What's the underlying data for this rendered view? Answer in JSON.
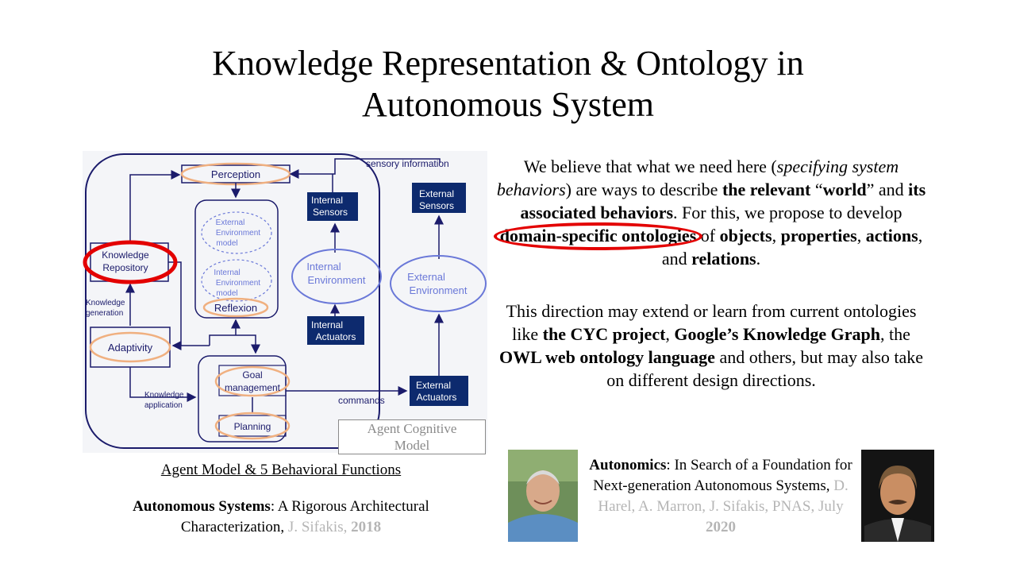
{
  "slide": {
    "title_line1": "Knowledge Representation & Ontology in",
    "title_line2": "Autonomous System"
  },
  "diagram": {
    "perception": "Perception",
    "sensory_information": "sensory information",
    "internal_sensors_1": "Internal",
    "internal_sensors_2": "Sensors",
    "external_sensors_1": "External",
    "external_sensors_2": "Sensors",
    "knowledge_repository_1": "Knowledge",
    "knowledge_repository_2": "Repository",
    "external_env_model_1": "External",
    "external_env_model_2": "Environment",
    "external_env_model_3": "model",
    "internal_env_model_1": "Internal",
    "internal_env_model_2": "Environment",
    "internal_env_model_3": "model",
    "internal_environment_1": "Internal",
    "internal_environment_2": "Environment",
    "external_environment_1": "External",
    "external_environment_2": "Environment",
    "knowledge_generation_1": "Knowledge",
    "knowledge_generation_2": "generation",
    "reflexion": "Reflexion",
    "internal_actuators_1": "Internal",
    "internal_actuators_2": "Actuators",
    "adaptivity": "Adaptivity",
    "goal_management_1": "Goal",
    "goal_management_2": "management",
    "knowledge_application_1": "Knowledge",
    "knowledge_application_2": "application",
    "commands": "commands",
    "external_actuators_1": "External",
    "external_actuators_2": "Actuators",
    "planning": "Planning",
    "agent_cognitive_model_1": "Agent Cognitive",
    "agent_cognitive_model_2": "Model",
    "colors": {
      "navy": "#1b1b6b",
      "box_fill": "#0d2a6e",
      "orange": "#f0b080",
      "red": "#e30000",
      "blue_ellipse": "#6a78d8"
    }
  },
  "left_caption": "Agent Model & 5 Behavioral Functions",
  "left_ref": {
    "bold": "Autonomous Systems",
    "text1": ": A Rigorous Architectural",
    "text2": "Characterization, ",
    "gray": "J. Sifakis, ",
    "year": "2018"
  },
  "para1": {
    "t1": "We believe that what we need here (",
    "i1": "specifying system behaviors",
    "t2": ") are ways to describe ",
    "b1": "the relevant",
    "t3": " “",
    "b2": "world",
    "t4": "” and ",
    "b3": "its associated behaviors",
    "t5": ". For this, we propose to develop ",
    "b4": "domain-specific ontologies",
    "t6": " of ",
    "b5": "objects",
    "t7": ", ",
    "b6": "properties",
    "t8": ", ",
    "b7": "actions",
    "t9": ", and ",
    "b8": "relations",
    "t10": "."
  },
  "para2": {
    "t1": "This direction may extend or learn from current ontologies like ",
    "b1": "the CYC project",
    "t2": ", ",
    "b2": "Google’s Knowledge Graph",
    "t3": ", the ",
    "b3": "OWL web ontology language",
    "t4": " and others, but may also take on different design directions."
  },
  "right_ref": {
    "bold": "Autonomics",
    "text1": ": In Search of a Foundation  for Next-generation Autonomous Systems, ",
    "gray1": "D. Harel, A. Marron, J. Sifakis, PNAS, July ",
    "year": "2020"
  },
  "photos": {
    "left_icon": "person-photo-icon",
    "right_icon": "person-photo-icon"
  }
}
